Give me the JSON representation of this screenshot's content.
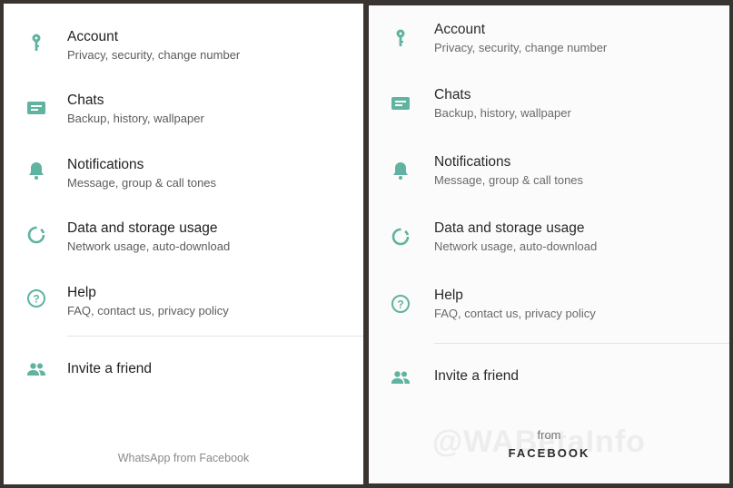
{
  "settings": {
    "account": {
      "title": "Account",
      "subtitle": "Privacy, security, change number",
      "icon": "key-icon"
    },
    "chats": {
      "title": "Chats",
      "subtitle": "Backup, history, wallpaper",
      "icon": "chat-icon"
    },
    "notifications": {
      "title": "Notifications",
      "subtitle": "Message, group & call tones",
      "icon": "bell-icon"
    },
    "data_storage": {
      "title": "Data and storage usage",
      "subtitle": "Network usage, auto-download",
      "icon": "data-usage-icon"
    },
    "help": {
      "title": "Help",
      "subtitle": "FAQ, contact us, privacy policy",
      "icon": "help-icon"
    },
    "invite": {
      "title": "Invite a friend",
      "icon": "people-icon"
    }
  },
  "left_footer": "WhatsApp from Facebook",
  "right_footer": {
    "from": "from",
    "brand": "FACEBOOK"
  },
  "watermark": "@WABetaInfo",
  "colors": {
    "accent": "#5fb3a0",
    "frame": "#3a3430"
  }
}
